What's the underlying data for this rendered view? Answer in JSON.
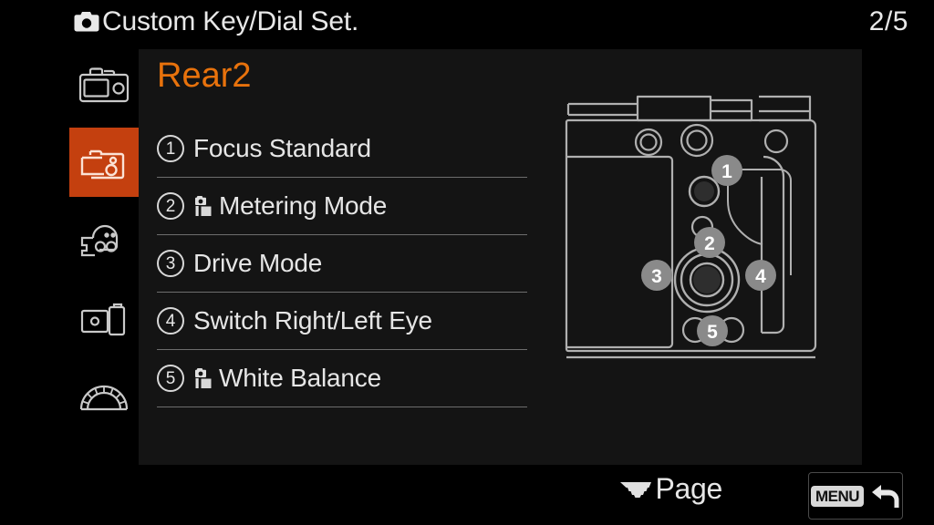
{
  "header": {
    "icon": "camera-icon",
    "title": "Custom Key/Dial Set.",
    "page_indicator": "2/5"
  },
  "sidebar": {
    "items": [
      {
        "name": "camera-body-icon",
        "label": "Shooting",
        "active": false
      },
      {
        "name": "camera-settings-icon",
        "label": "Custom Operation",
        "active": true
      },
      {
        "name": "network-icon",
        "label": "Network",
        "active": false
      },
      {
        "name": "playback-icon",
        "label": "Playback",
        "active": false
      },
      {
        "name": "setup-gauge-icon",
        "label": "Setup",
        "active": false
      }
    ],
    "active_color": "#c4400f"
  },
  "main": {
    "section_title": "Rear2",
    "section_title_color": "#e8720c",
    "items": [
      {
        "number": "1",
        "prefix_icon": "",
        "label": "Focus Standard"
      },
      {
        "number": "2",
        "prefix_icon": "still-image-icon",
        "label": "Metering Mode"
      },
      {
        "number": "3",
        "prefix_icon": "",
        "label": "Drive Mode"
      },
      {
        "number": "4",
        "prefix_icon": "",
        "label": "Switch Right/Left Eye"
      },
      {
        "number": "5",
        "prefix_icon": "still-image-icon",
        "label": "White Balance"
      }
    ]
  },
  "diagram": {
    "name": "camera-rear-diagram",
    "callouts": [
      "1",
      "2",
      "3",
      "4",
      "5"
    ],
    "callout_color": "#8a8a8a",
    "outline_color": "#b4b4b4"
  },
  "footer": {
    "page_icon": "control-dial-icon",
    "page_label": "Page",
    "menu_badge": "MENU",
    "back_icon": "back-arrow-icon"
  }
}
